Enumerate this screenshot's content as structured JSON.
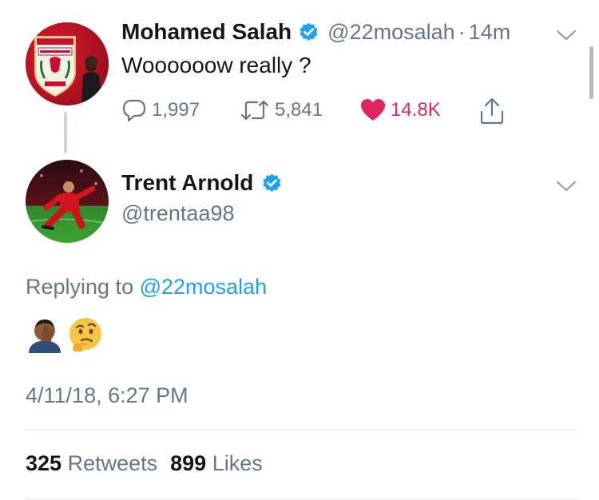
{
  "parent_tweet": {
    "author_name": "Mohamed Salah",
    "author_handle": "@22mosalah",
    "separator": "·",
    "time_ago": "14m",
    "text": "Woooooow really ?",
    "replies": "1,997",
    "retweets": "5,841",
    "likes": "14.8K"
  },
  "main_tweet": {
    "author_name": "Trent Arnold",
    "author_handle": "@trentaa98",
    "replying_prefix": "Replying to",
    "replying_handle": "@22mosalah",
    "emoji_1": "🤦🏾‍♂️",
    "emoji_2": "🤔",
    "timestamp": "4/11/18, 6:27 PM",
    "retweet_count": "325",
    "retweet_label": "Retweets",
    "like_count": "899",
    "like_label": "Likes"
  },
  "colors": {
    "verified": "#1da1f2",
    "link": "#1da1f2",
    "like": "#e0245e",
    "secondary_text": "#657786",
    "divider": "#e1e8ed",
    "liverpool_red": "#c8102e"
  }
}
